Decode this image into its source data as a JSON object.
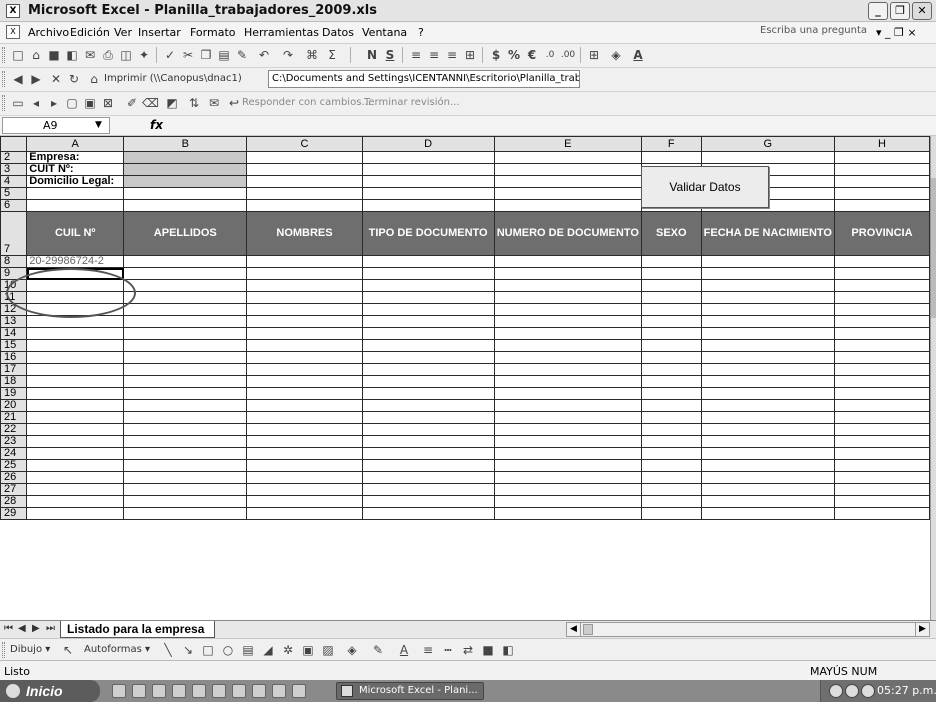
{
  "window": {
    "title": "Microsoft Excel - Planilla_trabajadores_2009.xls",
    "minimize": "_",
    "maximize": "❐",
    "close": "✕"
  },
  "menu": {
    "items": [
      "Archivo",
      "Edición",
      "Ver",
      "Insertar",
      "Formato",
      "Herramientas",
      "Datos",
      "Ventana",
      "?"
    ],
    "help_placeholder": "Escriba una pregunta",
    "doc_controls": "▾ _ ❐ ×"
  },
  "review_toolbar": {
    "respond": "Responder con cambios...",
    "end_review": "Terminar revisión..."
  },
  "web_toolbar": {
    "print_link": "Imprimir (\\\\Canopus\\dnac1)",
    "path": "C:\\Documents and Settings\\ICENTANNI\\Escritorio\\Planilla_trabajad"
  },
  "formula_bar": {
    "name_box": "A9",
    "fx": "fx",
    "formula": ""
  },
  "grid": {
    "columns": [
      "A",
      "B",
      "C",
      "D",
      "E",
      "F",
      "G",
      "H"
    ],
    "company_labels": [
      "Empresa:",
      "CUIT Nº:",
      "Domicilio Legal:"
    ],
    "headers": [
      "CUIL Nº",
      "APELLIDOS",
      "NOMBRES",
      "TIPO DE DOCUMENTO",
      "NUMERO DE DOCUMENTO",
      "SEXO",
      "FECHA DE NACIMIENTO",
      "PROVINCIA"
    ],
    "row8_cuil": "20-29986724-2",
    "first_data_row": 8,
    "last_row": 29
  },
  "validar_button": "Validar Datos",
  "sheet_tabs": {
    "active": "Listado para la empresa"
  },
  "drawing_toolbar": {
    "dibujo": "Dibujo ▾",
    "autoformas": "Autoformas ▾"
  },
  "status": {
    "left": "Listo",
    "indicators": "MAYÚS NUM"
  },
  "taskbar": {
    "start": "Inicio",
    "task": "Microsoft Excel - Plani...",
    "clock": "05:27 p.m."
  }
}
